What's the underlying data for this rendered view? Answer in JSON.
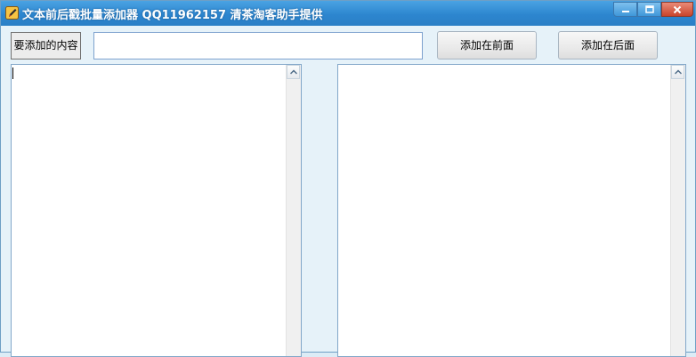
{
  "window": {
    "title": "文本前后戳批量添加器 QQ11962157 清茶淘客助手提供"
  },
  "toolbar": {
    "content_label": "要添加的内容",
    "content_value": "",
    "add_front_label": "添加在前面",
    "add_back_label": "添加在后面"
  },
  "panes": {
    "input_text": "",
    "output_text": ""
  },
  "icons": {
    "app": "pencil-note-icon",
    "minimize": "minimize-icon",
    "maximize": "maximize-icon",
    "close": "close-icon",
    "scroll_up": "chevron-up-icon"
  },
  "colors": {
    "titlebar": "#2d86cf",
    "window_bg": "#e6f2f9",
    "close_button": "#c9442b"
  }
}
